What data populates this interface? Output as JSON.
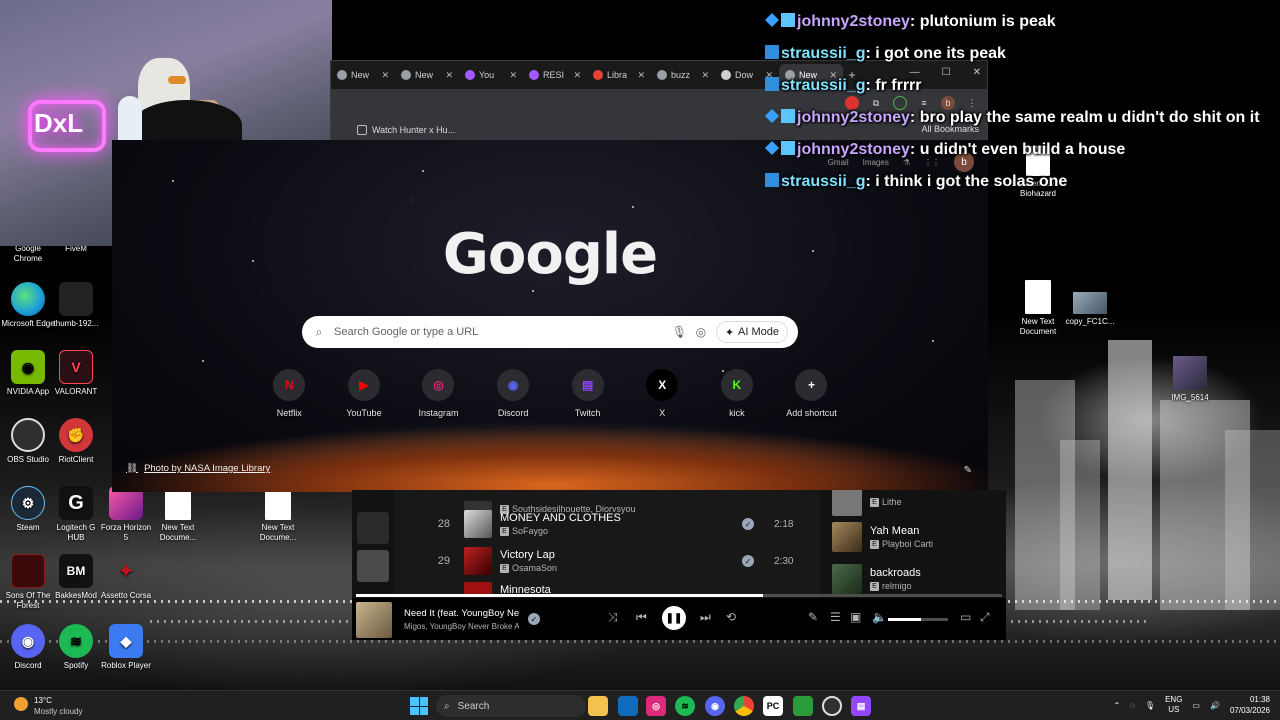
{
  "browser": {
    "tabs": [
      {
        "label": "New",
        "color": "#9aa0a6",
        "active": false
      },
      {
        "label": "New",
        "color": "#9aa0a6",
        "active": false
      },
      {
        "label": "You",
        "color": "#a259ff",
        "active": false
      },
      {
        "label": "RESI",
        "color": "#a259ff",
        "active": false
      },
      {
        "label": "Libra",
        "color": "#ea4335",
        "active": false
      },
      {
        "label": "buzz",
        "color": "#9aa0a6",
        "active": false
      },
      {
        "label": "Dow",
        "color": "#cfcfcf",
        "active": false
      },
      {
        "label": "New",
        "color": "#9aa0a6",
        "active": true
      }
    ],
    "new_tab_symbol": "+",
    "minimize_symbol": "—",
    "maximize_symbol": "☐",
    "close_symbol": "✕",
    "bookmark_label": "Watch Hunter x Hu...",
    "all_bookmarks_label": "All Bookmarks",
    "ntp": {
      "gmail_label": "Gmail",
      "images_label": "Images",
      "avatar_letter": "b",
      "logo": "Google",
      "search_placeholder": "Search Google or type a URL",
      "ai_mode_label": "AI Mode",
      "photo_credit": "Photo by NASA Image Library",
      "shortcuts": [
        {
          "label": "Netflix",
          "glyph": "N",
          "color": "#e50914"
        },
        {
          "label": "YouTube",
          "glyph": "▶",
          "color": "#ff0000"
        },
        {
          "label": "Instagram",
          "glyph": "◎",
          "color": "#dd2a7b"
        },
        {
          "label": "Discord",
          "glyph": "◉",
          "color": "#5865f2"
        },
        {
          "label": "Twitch",
          "glyph": "▤",
          "color": "#9146ff"
        },
        {
          "label": "X",
          "glyph": "X",
          "color": "#ffffff"
        },
        {
          "label": "kick",
          "glyph": "K",
          "color": "#53fc18"
        },
        {
          "label": "Add shortcut",
          "glyph": "+",
          "color": "#ffffff"
        }
      ]
    }
  },
  "chat": [
    {
      "user": "johnny2stoney",
      "text": "plutonium is peak",
      "color": "#c7a6ff"
    },
    {
      "user": "straussii_g",
      "text": "i got one its peak",
      "color": "#7fe0ff"
    },
    {
      "user": "straussii_g",
      "text": "fr frrrr",
      "color": "#7fe0ff"
    },
    {
      "user": "johnny2stoney",
      "text": "bro play the same realm u didn't do shit on it",
      "color": "#c7a6ff"
    },
    {
      "user": "johnny2stoney",
      "text": "u didn't even build a house",
      "color": "#c7a6ff"
    },
    {
      "user": "straussii_g",
      "text": "i think i got the solas one",
      "color": "#7fe0ff"
    }
  ],
  "spotify": {
    "partial_row_artist": "Southsidesilhouette, Diorvsyou",
    "tracks": [
      {
        "num": "28",
        "title": "MONEY AND CLOTHES",
        "artist": "SoFaygo",
        "duration": "2:18"
      },
      {
        "num": "29",
        "title": "Victory Lap",
        "artist": "OsamaSon",
        "duration": "2:30"
      },
      {
        "num": "",
        "title": "Minnesota",
        "artist": "",
        "duration": ""
      }
    ],
    "explicit": "E",
    "queue": [
      {
        "title": "",
        "artist": "Lithe"
      },
      {
        "title": "Yah Mean",
        "artist": "Playboi Carti"
      },
      {
        "title": "backroads",
        "artist": "relmigo"
      }
    ],
    "now_playing": {
      "title": "Need It (feat. YoungBoy Never Broke Again)",
      "artist": "Migos, YoungBoy Never Broke Again",
      "progress": 0.63,
      "volume": 0.55
    }
  },
  "desktop_icons": [
    {
      "label": "Google Chrome",
      "color": "#3c3c3c"
    },
    {
      "label": "FiveM",
      "color": "#f08a24"
    },
    {
      "label": "Microsoft Edge",
      "color": "#1fa3d6"
    },
    {
      "label": "thumb-192...",
      "color": "#222222"
    },
    {
      "label": "NVIDIA App",
      "color": "#76b900"
    },
    {
      "label": "VALORANT",
      "color": "#ff4655"
    },
    {
      "label": "OBS Studio",
      "color": "#302e31"
    },
    {
      "label": "RiotClient",
      "color": "#d13639"
    },
    {
      "label": "Steam",
      "color": "#1b2838"
    },
    {
      "label": "Logitech G HUB",
      "color": "#111111"
    },
    {
      "label": "Forza Horizon 5",
      "color": "#d12d8a"
    },
    {
      "label": "New Text Docume...",
      "color": "#ffffff"
    },
    {
      "label": "New Text Docume...",
      "color": "#ffffff"
    },
    {
      "label": "Sons Of The Forest",
      "color": "#8a1a1a"
    },
    {
      "label": "BakkesMod",
      "color": "#111111"
    },
    {
      "label": "Assetto Corsa",
      "color": "#c1121f"
    },
    {
      "label": "Discord",
      "color": "#5865f2"
    },
    {
      "label": "Spotify",
      "color": "#1db954"
    },
    {
      "label": "Roblox Player",
      "color": "#3b7bf2"
    },
    {
      "label": "Resident Evil 7 Biohazard",
      "color": "#ffffff"
    },
    {
      "label": "New Text Document",
      "color": "#ffffff"
    },
    {
      "label": "copy_FC1C...",
      "color": "#6a8fb0"
    },
    {
      "label": "IMG_5614",
      "color": "#5a4a7a"
    }
  ],
  "taskbar": {
    "temperature": "13°C",
    "weather": "Mostly cloudy",
    "search_label": "Search",
    "lang_top": "ENG",
    "lang_bottom": "US",
    "time": "01:38",
    "date": "07/03/2026"
  }
}
